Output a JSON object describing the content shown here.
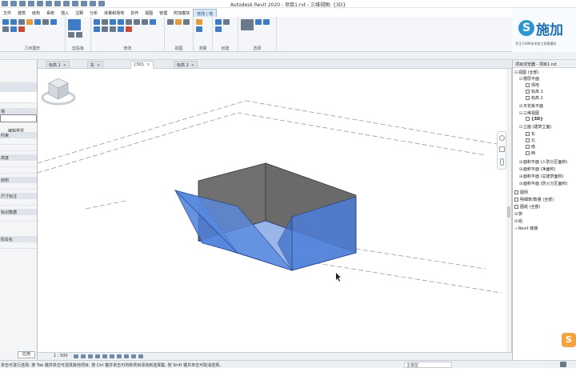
{
  "window": {
    "title": "Autodesk Revit 2020 - 项目1.rvt - 三维视图: {3D}"
  },
  "ribbon": {
    "tabs": [
      {
        "label": "文件"
      },
      {
        "label": "建筑"
      },
      {
        "label": "结构"
      },
      {
        "label": "系统"
      },
      {
        "label": "插入"
      },
      {
        "label": "注释"
      },
      {
        "label": "分析"
      },
      {
        "label": "体量和场地"
      },
      {
        "label": "协作"
      },
      {
        "label": "视图"
      },
      {
        "label": "管理"
      },
      {
        "label": "附加模块"
      },
      {
        "label": "修改 | 墙"
      }
    ],
    "groups": [
      {
        "label": "几何图形"
      },
      {
        "label": "剪贴板"
      },
      {
        "label": "修改"
      },
      {
        "label": "视图"
      },
      {
        "label": "测量"
      },
      {
        "label": "创建"
      },
      {
        "label": "选择"
      }
    ]
  },
  "logo": {
    "mark": "S",
    "text": "施加",
    "subtitle": "专注于BIM技术和工程建模的"
  },
  "properties": {
    "edit_type": "编辑类型",
    "labels": [
      "墙",
      "约束",
      "高度",
      "结构",
      "尺寸标注",
      "标识数据",
      "阶段化"
    ],
    "apply": "应用"
  },
  "view_tabs": [
    {
      "label": "标高 1"
    },
    {
      "label": "东"
    },
    {
      "label": "{3D}"
    },
    {
      "label": "标高 2"
    }
  ],
  "view_control": {
    "scale": "1 : 500"
  },
  "project_browser": {
    "title": "项目浏览器 - 项目1.rvt",
    "items": [
      {
        "label": "视图 (全部)"
      },
      {
        "label": "楼层平面"
      },
      {
        "label": "场地"
      },
      {
        "label": "标高 1"
      },
      {
        "label": "标高 2"
      },
      {
        "label": "天花板平面"
      },
      {
        "label": "三维视图"
      },
      {
        "label": "{3D}"
      },
      {
        "label": "立面 (建筑立面)"
      },
      {
        "label": "东"
      },
      {
        "label": "北"
      },
      {
        "label": "南"
      },
      {
        "label": "西"
      },
      {
        "label": "面积平面 (人防分区面积)"
      },
      {
        "label": "面积平面 (净面积)"
      },
      {
        "label": "面积平面 (总建筑面积)"
      },
      {
        "label": "面积平面 (防火分区面积)"
      },
      {
        "label": "图例"
      },
      {
        "label": "明细表/数量 (全部)"
      },
      {
        "label": "图纸 (全部)"
      },
      {
        "label": "族"
      },
      {
        "label": "组"
      },
      {
        "label": "Revit 链接"
      }
    ]
  },
  "status": {
    "hint": "单击可进行选择; 按 Tab 键并单击可选择其他项目; 按 Ctrl 键并单击可将新项目添加到选择集; 按 Shift 键并单击可取消选择。",
    "model_field": "主模型"
  },
  "colors": {
    "wall_selected": "#4d7fd9",
    "wall_dark": "#6f6f6f",
    "accent": "#3e7cc6",
    "logo_blue": "#1f6fb4"
  }
}
